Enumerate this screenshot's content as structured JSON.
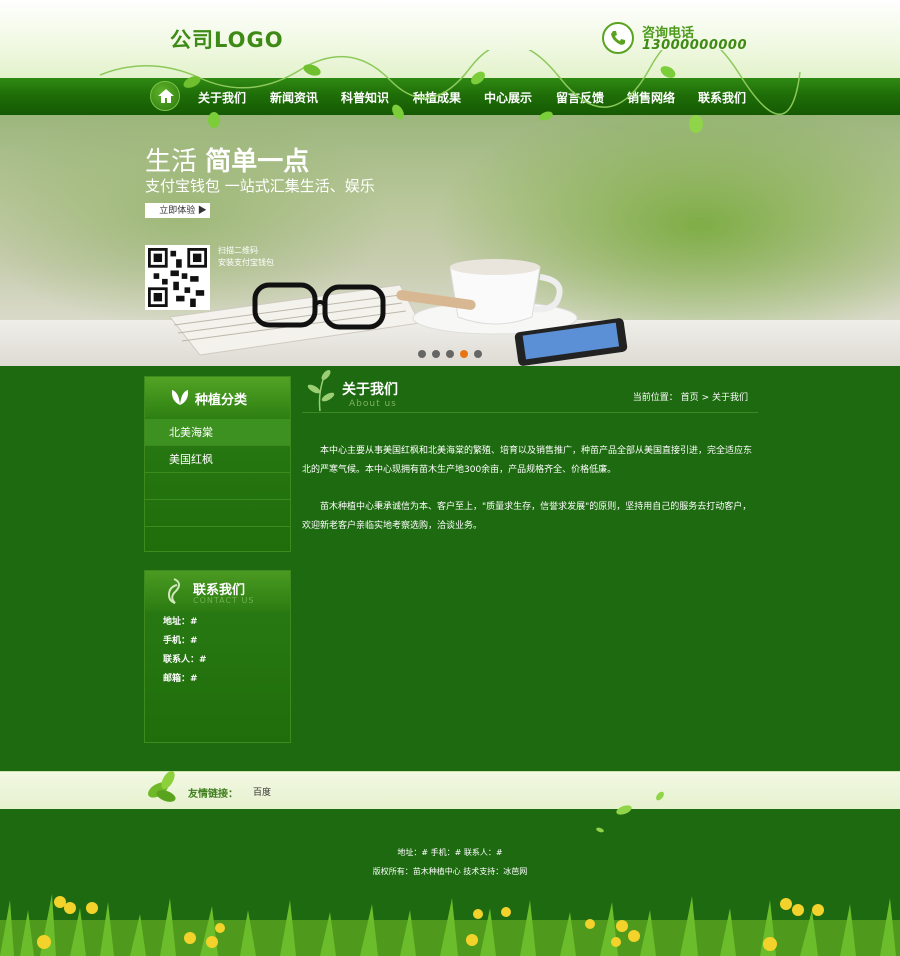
{
  "header": {
    "logo_text": "公司LOGO",
    "phone_label": "咨询电话",
    "phone_number": "13000000000"
  },
  "nav": {
    "items": [
      "关于我们",
      "新闻资讯",
      "科普知识",
      "种植成果",
      "中心展示",
      "留言反馈",
      "销售网络",
      "联系我们"
    ]
  },
  "banner": {
    "title_plain": "生活",
    "title_bold": "简单一点",
    "subtitle": "支付宝钱包 一站式汇集生活、娱乐",
    "button_label": "立即体验 ▶",
    "qr_line1": "扫描二维码",
    "qr_line2": "安装支付宝钱包",
    "slides": 5,
    "active_slide": 4
  },
  "sidebar": {
    "category_title": "种植分类",
    "categories": [
      "北美海棠",
      "美国红枫",
      "",
      "",
      ""
    ],
    "contact_title": "联系我们",
    "contact_subtitle": "CONTACT US",
    "contact_lines": [
      "地址：#",
      "手机：#",
      "联系人：#",
      "邮箱：#"
    ]
  },
  "main": {
    "title": "关于我们",
    "subtitle": "About us",
    "breadcrumb_label": "当前位置：",
    "breadcrumb_home": "首页",
    "breadcrumb_sep": ">",
    "breadcrumb_current": "关于我们",
    "paragraphs": [
      "本中心主要从事美国红枫和北美海棠的繁殖、培育以及销售推广，种苗产品全部从美国直接引进，完全适应东北的严寒气候。本中心现拥有苗木生产地300余亩，产品规格齐全、价格低廉。",
      "苗木种植中心秉承诚信为本、客户至上，\"质量求生存，信誉求发展\"的原则，坚持用自己的服务去打动客户，欢迎新老客户亲临实地考察选购，洽谈业务。"
    ]
  },
  "links": {
    "label": "友情链接：",
    "items": [
      "百度"
    ]
  },
  "footer": {
    "line1": "地址：#    手机：#    联系人：#",
    "line2": "版权所有：苗木种植中心    技术支持：冰芭网"
  },
  "colors": {
    "primary_green": "#1d6a10",
    "nav_green": "#1f6e08",
    "accent_orange": "#e87514"
  }
}
